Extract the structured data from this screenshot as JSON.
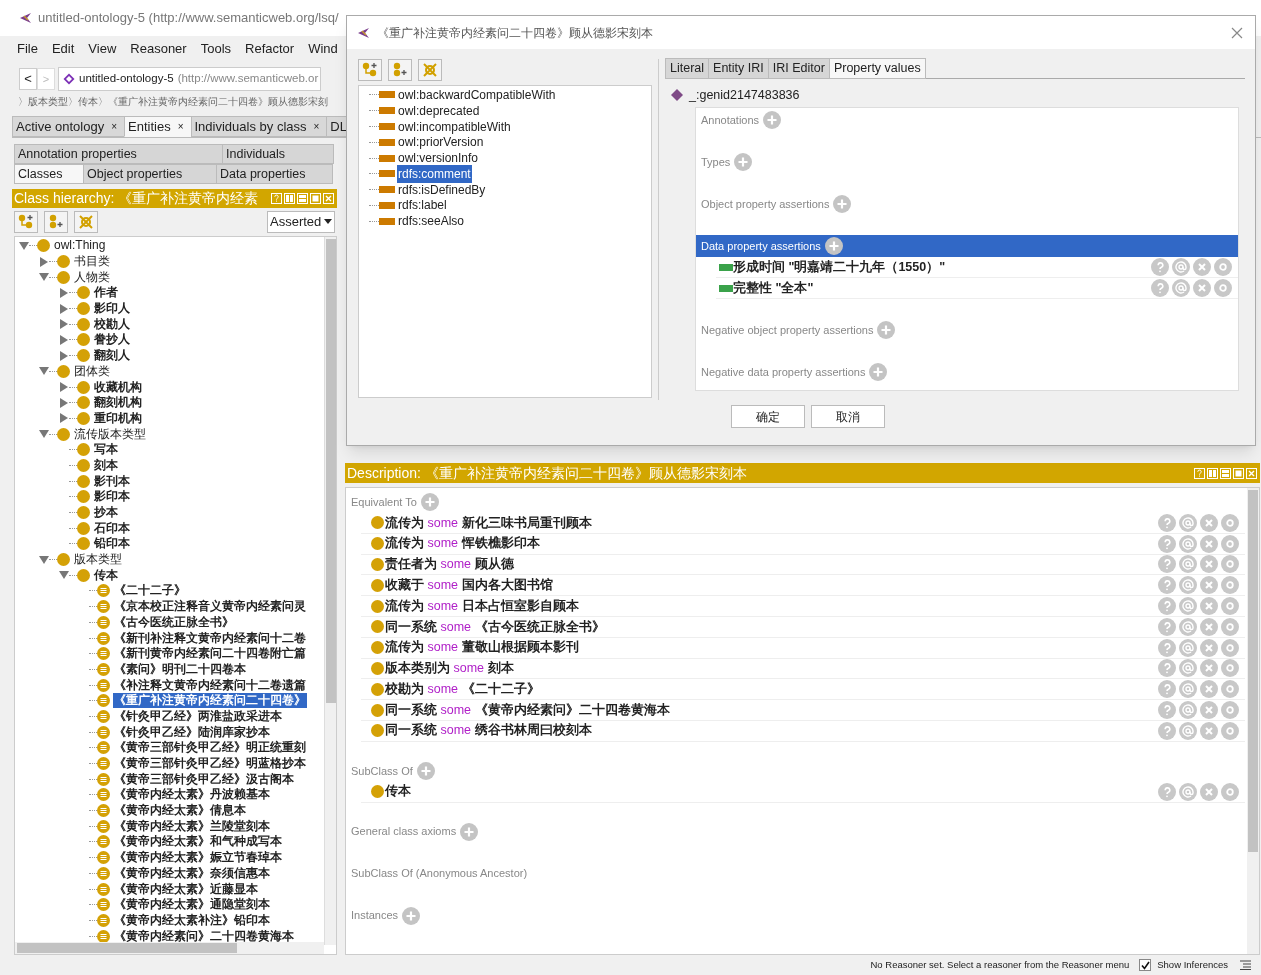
{
  "window": {
    "title": "untitled-ontology-5 (http://www.semanticweb.org/lsq/"
  },
  "menu": [
    "File",
    "Edit",
    "View",
    "Reasoner",
    "Tools",
    "Refactor",
    "Wind"
  ],
  "navigation": {
    "back": "<",
    "forward": ">",
    "ontology_name": "untitled-ontology-5",
    "ontology_iri": "(http://www.semanticweb.or"
  },
  "breadcrumb": "〉版本类型〉传本〉《重广补注黄帝内经素问二十四卷》顾从德影宋刻",
  "tabs": [
    {
      "label": "Active ontology",
      "close": "×",
      "selected": false
    },
    {
      "label": "Entities",
      "close": "×",
      "selected": true
    },
    {
      "label": "Individuals by class",
      "close": "×",
      "selected": false
    },
    {
      "label": "DL",
      "selected": false
    }
  ],
  "entity_tabs": [
    [
      {
        "label": "Annotation properties",
        "selected": false
      },
      {
        "label": "Individuals",
        "selected": false
      }
    ],
    [
      {
        "label": "Classes",
        "selected": true
      },
      {
        "label": "Object properties",
        "selected": false
      },
      {
        "label": "Data properties",
        "selected": false
      }
    ]
  ],
  "class_hierarchy": {
    "title": "Class hierarchy: 《重广补注黄帝内经素",
    "mode": "Asserted",
    "tree": [
      {
        "label": "owl:Thing",
        "kind": "class",
        "expanded": true,
        "selected": false,
        "children": [
          {
            "label": "书目类",
            "kind": "class",
            "expanded": false,
            "selected": false
          },
          {
            "label": "人物类",
            "kind": "class",
            "expanded": true,
            "selected": false,
            "children": [
              {
                "label": "作者",
                "kind": "class",
                "expanded": false,
                "selected": false
              },
              {
                "label": "影印人",
                "kind": "class",
                "expanded": false,
                "selected": false
              },
              {
                "label": "校勘人",
                "kind": "class",
                "expanded": false,
                "selected": false
              },
              {
                "label": "誊抄人",
                "kind": "class",
                "expanded": false,
                "selected": false
              },
              {
                "label": "翻刻人",
                "kind": "class",
                "expanded": false,
                "selected": false
              }
            ]
          },
          {
            "label": "团体类",
            "kind": "class",
            "expanded": true,
            "selected": false,
            "children": [
              {
                "label": "收藏机构",
                "kind": "class",
                "expanded": false,
                "selected": false
              },
              {
                "label": "翻刻机构",
                "kind": "class",
                "expanded": false,
                "selected": false
              },
              {
                "label": "重印机构",
                "kind": "class",
                "expanded": false,
                "selected": false
              }
            ]
          },
          {
            "label": "流传版本类型",
            "kind": "class",
            "expanded": true,
            "selected": false,
            "children": [
              {
                "label": "写本",
                "kind": "class",
                "selected": false
              },
              {
                "label": "刻本",
                "kind": "class",
                "selected": false
              },
              {
                "label": "影刊本",
                "kind": "class",
                "selected": false
              },
              {
                "label": "影印本",
                "kind": "class",
                "selected": false
              },
              {
                "label": "抄本",
                "kind": "class",
                "selected": false
              },
              {
                "label": "石印本",
                "kind": "class",
                "selected": false
              },
              {
                "label": "铅印本",
                "kind": "class",
                "selected": false
              }
            ]
          },
          {
            "label": "版本类型",
            "kind": "class",
            "expanded": true,
            "selected": false,
            "children": [
              {
                "label": "传本",
                "kind": "class",
                "expanded": true,
                "selected": false,
                "children": [
                  {
                    "label": "《二十二子》",
                    "kind": "individual",
                    "selected": false
                  },
                  {
                    "label": "《京本校正注释音义黄帝内经素问灵",
                    "kind": "individual",
                    "selected": false
                  },
                  {
                    "label": "《古今医统正脉全书》",
                    "kind": "individual",
                    "selected": false
                  },
                  {
                    "label": "《新刊补注释文黄帝内经素问十二卷",
                    "kind": "individual",
                    "selected": false
                  },
                  {
                    "label": "《新刊黄帝内经素问二十四卷附亡篇",
                    "kind": "individual",
                    "selected": false
                  },
                  {
                    "label": "《素问》明刊二十四卷本",
                    "kind": "individual",
                    "selected": false
                  },
                  {
                    "label": "《补注释文黄帝内经素问十二卷遗篇",
                    "kind": "individual",
                    "selected": false
                  },
                  {
                    "label": "《重广补注黄帝内经素问二十四卷》",
                    "kind": "individual",
                    "selected": true
                  },
                  {
                    "label": "《针灸甲乙经》两淮盐政采进本",
                    "kind": "individual",
                    "selected": false
                  },
                  {
                    "label": "《针灸甲乙经》陆润庠家抄本",
                    "kind": "individual",
                    "selected": false
                  },
                  {
                    "label": "《黄帝三部针灸甲乙经》明正统重刻",
                    "kind": "individual",
                    "selected": false
                  },
                  {
                    "label": "《黄帝三部针灸甲乙经》明蓝格抄本",
                    "kind": "individual",
                    "selected": false
                  },
                  {
                    "label": "《黄帝三部针灸甲乙经》汲古阁本",
                    "kind": "individual",
                    "selected": false
                  },
                  {
                    "label": "《黄帝内经太素》丹波赖基本",
                    "kind": "individual",
                    "selected": false
                  },
                  {
                    "label": "《黄帝内经太素》倩息本",
                    "kind": "individual",
                    "selected": false
                  },
                  {
                    "label": "《黄帝内经太素》兰陵堂刻本",
                    "kind": "individual",
                    "selected": false
                  },
                  {
                    "label": "《黄帝内经太素》和气种成写本",
                    "kind": "individual",
                    "selected": false
                  },
                  {
                    "label": "《黄帝内经太素》娠立节春琸本",
                    "kind": "individual",
                    "selected": false
                  },
                  {
                    "label": "《黄帝内经太素》奈须信惠本",
                    "kind": "individual",
                    "selected": false
                  },
                  {
                    "label": "《黄帝内经太素》近藤显本",
                    "kind": "individual",
                    "selected": false
                  },
                  {
                    "label": "《黄帝内经太素》通隐堂刻本",
                    "kind": "individual",
                    "selected": false
                  },
                  {
                    "label": "《黄帝内经太素补注》铅印本",
                    "kind": "individual",
                    "selected": false
                  },
                  {
                    "label": "《黄帝内经素问》二十四卷黄海本",
                    "kind": "individual",
                    "selected": false
                  }
                ]
              }
            ]
          }
        ]
      }
    ]
  },
  "dialog": {
    "title": "《重广补注黄帝内经素问二十四卷》顾从德影宋刻本",
    "properties": [
      {
        "label": "owl:backwardCompatibleWith",
        "selected": false
      },
      {
        "label": "owl:deprecated",
        "selected": false
      },
      {
        "label": "owl:incompatibleWith",
        "selected": false
      },
      {
        "label": "owl:priorVersion",
        "selected": false
      },
      {
        "label": "owl:versionInfo",
        "selected": false
      },
      {
        "label": "rdfs:comment",
        "selected": true
      },
      {
        "label": "rdfs:isDefinedBy",
        "selected": false
      },
      {
        "label": "rdfs:label",
        "selected": false
      },
      {
        "label": "rdfs:seeAlso",
        "selected": false
      }
    ],
    "tabs": [
      {
        "label": "Literal",
        "selected": false
      },
      {
        "label": "Entity IRI",
        "selected": false
      },
      {
        "label": "IRI Editor",
        "selected": false
      },
      {
        "label": "Property values",
        "selected": true
      }
    ],
    "individual": "_:genid2147483836",
    "sections": [
      {
        "title": "Annotations",
        "selected": false
      },
      {
        "title": "Types",
        "selected": false
      },
      {
        "title": "Object property assertions",
        "selected": false
      },
      {
        "title": "Data property assertions",
        "selected": true,
        "items": [
          "形成时间 \"明嘉靖二十九年（1550）\"",
          "完整性 \"全本\""
        ]
      },
      {
        "title": "Negative object property assertions",
        "selected": false
      },
      {
        "title": "Negative data property assertions",
        "selected": false
      }
    ],
    "buttons": [
      "确定",
      "取消"
    ]
  },
  "description": {
    "title": "Description: 《重广补注黄帝内经素问二十四卷》顾从德影宋刻本",
    "sections": [
      {
        "title": "Equivalent To",
        "addable": true,
        "items": [
          {
            "kind": "restriction",
            "property": "流传为",
            "quantifier": "some",
            "filler": "新化三味书局重刊顾本"
          },
          {
            "kind": "restriction",
            "property": "流传为",
            "quantifier": "some",
            "filler": "恽铁樵影印本"
          },
          {
            "kind": "restriction",
            "property": "责任者为",
            "quantifier": "some",
            "filler": "顾从德"
          },
          {
            "kind": "restriction",
            "property": "收藏于",
            "quantifier": "some",
            "filler": "国内各大图书馆"
          },
          {
            "kind": "restriction",
            "property": "流传为",
            "quantifier": "some",
            "filler": "日本占恒室影自顾本"
          },
          {
            "kind": "restriction",
            "property": "同一系统",
            "quantifier": "some",
            "filler": "《古今医统正脉全书》"
          },
          {
            "kind": "restriction",
            "property": "流传为",
            "quantifier": "some",
            "filler": "董敬山根据顾本影刊"
          },
          {
            "kind": "restriction",
            "property": "版本类别为",
            "quantifier": "some",
            "filler": "刻本"
          },
          {
            "kind": "restriction",
            "property": "校勘为",
            "quantifier": "some",
            "filler": "《二十二子》"
          },
          {
            "kind": "restriction",
            "property": "同一系统",
            "quantifier": "some",
            "filler": "《黄帝内经素问》二十四卷黄海本"
          },
          {
            "kind": "restriction",
            "property": "同一系统",
            "quantifier": "some",
            "filler": "绣谷书林周曰校刻本"
          }
        ]
      },
      {
        "title": "SubClass Of",
        "addable": true,
        "items": [
          {
            "kind": "class",
            "label": "传本"
          }
        ]
      },
      {
        "title": "General class axioms",
        "addable": true
      },
      {
        "title": "SubClass Of (Anonymous Ancestor)",
        "addable": false
      },
      {
        "title": "Instances",
        "addable": true
      }
    ]
  },
  "status_bar": {
    "message": "No Reasoner set. Select a reasoner from the Reasoner menu",
    "show_inferences": {
      "label": "Show Inferences",
      "checked": true
    }
  }
}
